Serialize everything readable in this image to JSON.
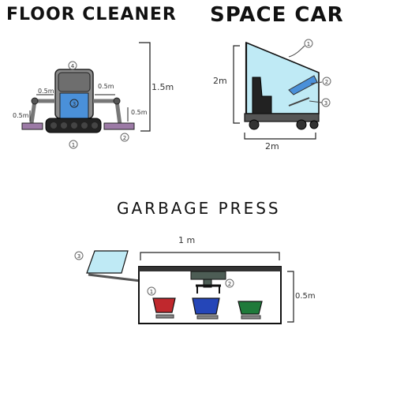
{
  "diagrams": {
    "floor_cleaner": {
      "title": "FLOOR CLEANER",
      "dim_height": "1.5m",
      "dim_arm_left": "0.5m",
      "dim_arm_right": "0.5m",
      "dim_pad_left": "0.5m",
      "dim_pad_right": "0.5m",
      "callouts": [
        "1",
        "2",
        "3",
        "4"
      ]
    },
    "space_car": {
      "title": "SPACE CAR",
      "dim_height": "2m",
      "dim_width": "2m",
      "callouts": [
        "1",
        "2",
        "3"
      ]
    },
    "garbage_press": {
      "title": "GARBAGE PRESS",
      "dim_width": "1 m",
      "dim_height": "0.5m",
      "callouts": [
        "1",
        "2",
        "3"
      ]
    }
  },
  "colors": {
    "body_blue": "#4a90d9",
    "screen_cyan": "#bfeaf5",
    "tread": "#222222",
    "pad_purple": "#9c7aa6",
    "bin_red": "#c0282d",
    "bin_blue": "#2546b8",
    "bin_green": "#1f7a3a",
    "arm_grey": "#777777",
    "press_grey": "#4d5d55"
  }
}
